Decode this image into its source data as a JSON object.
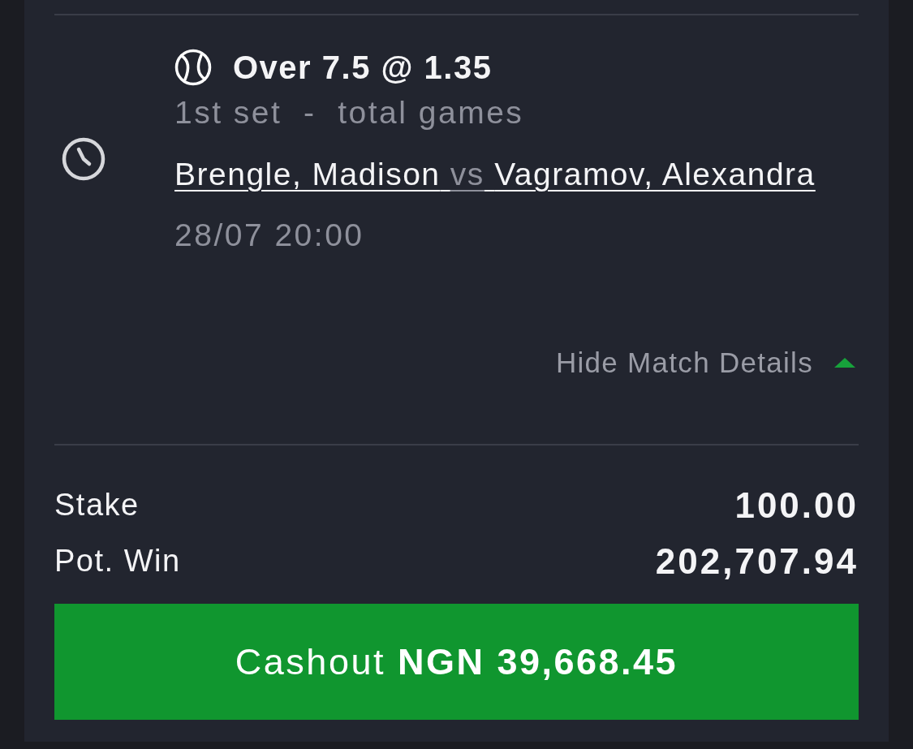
{
  "bet": {
    "selection": "Over 7.5 @ 1.35",
    "market": "1st set  -  total games",
    "match": {
      "home": "Brengle, Madison",
      "separator": "vs",
      "away": "Vagramov, Alexandra"
    },
    "date": "28/07 20:00"
  },
  "details_toggle": {
    "label": "Hide Match Details",
    "expanded": true
  },
  "summary": [
    {
      "label": "Stake",
      "value": "100.00"
    },
    {
      "label": "Pot. Win",
      "value": "202,707.94"
    }
  ],
  "cashout_button": {
    "label": "Cashout **NGN 39,668.45**"
  }
}
